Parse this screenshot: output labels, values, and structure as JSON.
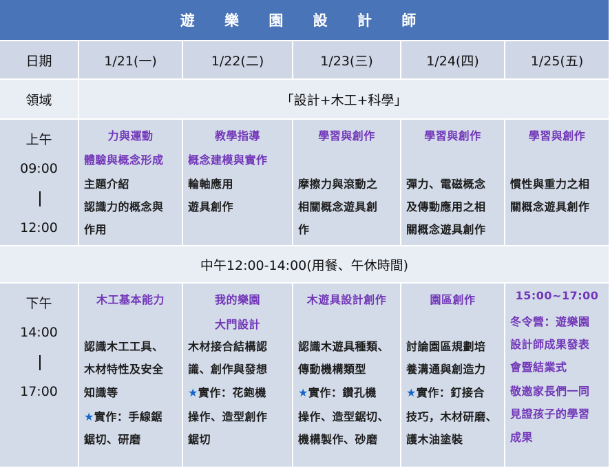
{
  "title": "遊 樂 園 設 計 師",
  "header": {
    "date_label": "日期",
    "days": [
      "1/21(一)",
      "1/22(二)",
      "1/23(三)",
      "1/24(四)",
      "1/25(五)"
    ]
  },
  "domain_row": {
    "label": "領域",
    "value": "「設計+木工+科學」"
  },
  "morning": {
    "label": "上午",
    "start": "09:00",
    "end": "12:00",
    "cells": [
      [
        "力與運動",
        "體驗與概念形成",
        "主題介紹",
        "認識力的概念與",
        "作用"
      ],
      [
        "教學指導",
        "概念建模與實作",
        "輪軸應用",
        "遊具創作"
      ],
      [
        "學習與創作",
        "摩擦力與滾動之",
        "相關概念遊具創",
        "作"
      ],
      [
        "學習與創作",
        "彈力、電磁概念",
        "及傳動應用之相",
        "關概念遊具創作"
      ],
      [
        "學習與創作",
        "慣性與重力之相",
        "關概念遊具創作"
      ]
    ]
  },
  "lunch": "中午12:00-14:00(用餐、午休時間)",
  "afternoon": {
    "label": "下午",
    "start": "14:00",
    "end": "17:00",
    "cells": [
      [
        "木工基本能力",
        "認識木工工具、",
        "木材特性及安全",
        "知識等",
        "實作：手線鋸",
        "鋸切、研磨"
      ],
      [
        "我的樂園",
        "大門設計",
        "木材接合結構認",
        "識、創作與發想",
        "實作：花鉋機",
        "操作、造型創作",
        "鋸切"
      ],
      [
        "木遊具設計創作",
        "認識木遊具種類、",
        "傳動機構類型",
        "實作：鑽孔機",
        "操作、造型鋸切、",
        "機構製作、砂磨"
      ],
      [
        "園區創作",
        "討論園區規劃培",
        "養溝通與創造力",
        "實作：釘接合",
        "技巧，木材研磨、",
        "護木油塗裝"
      ],
      [
        "15:00~17:00",
        "冬令營：遊樂園",
        "設計師成果發表",
        "會暨結業式",
        "敬邀家長們一同",
        "見證孩子的學習",
        "成果"
      ]
    ]
  },
  "colors": {
    "title_bg": "#4a74b8",
    "row_dark": "#d3dbe9",
    "row_light": "#e9edf4",
    "heading_purple": "#7236b8",
    "star_blue": "#1565c8"
  },
  "icons": {
    "practice_marker": "star-icon"
  }
}
